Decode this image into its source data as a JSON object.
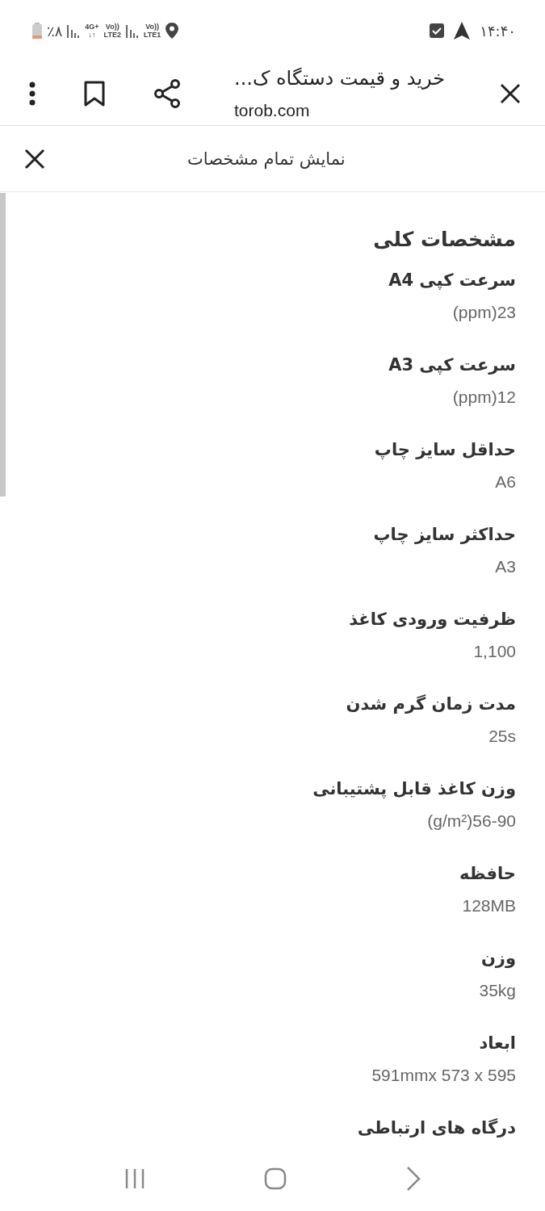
{
  "status_bar": {
    "time": "۱۴:۴۰",
    "battery": "٪۸",
    "network_1": {
      "top": "4G+",
      "bottom": "↓↑"
    },
    "network_2": {
      "top": "Vo))",
      "bottom": "LTE2"
    },
    "network_3": {
      "top": "Vo))",
      "bottom": "LTE1"
    }
  },
  "toolbar": {
    "title": "خرید و قیمت دستگاه ک...",
    "url": "torob.com"
  },
  "panel": {
    "title": "نمایش تمام مشخصات",
    "section_title": "مشخصات کلی",
    "specs": [
      {
        "label": "سرعت کپی A4",
        "value": "(ppm)23"
      },
      {
        "label": "سرعت کپی A3",
        "value": "(ppm)12"
      },
      {
        "label": "حداقل سایز چاپ",
        "value": "A6"
      },
      {
        "label": "حداکثر سایز چاپ",
        "value": "A3"
      },
      {
        "label": "ظرفیت ورودی کاغذ",
        "value": "1,100"
      },
      {
        "label": "مدت زمان گرم شدن",
        "value": "25s"
      },
      {
        "label": "وزن کاغذ قابل پشتیبانی",
        "value": "(g/m²)56-90"
      },
      {
        "label": "حافظه",
        "value": "128MB"
      },
      {
        "label": "وزن",
        "value": "35kg"
      },
      {
        "label": "ابعاد",
        "value": "591mmx 573 x 595"
      },
      {
        "label": "درگاه های ارتباطی"
      }
    ]
  }
}
